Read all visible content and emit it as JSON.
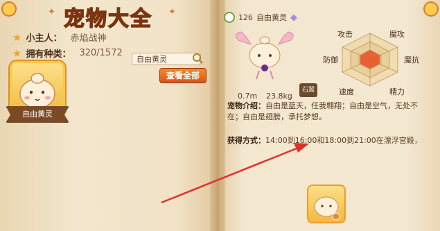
{
  "title": "宠物大全",
  "owner": {
    "label": "小主人：",
    "value": "赤焰战神"
  },
  "species": {
    "label": "拥有种类：",
    "value": "320/1572"
  },
  "selected_pet": {
    "name": "自由黄灵"
  },
  "search": {
    "value": "自由黄灵",
    "icon": "magnifier-icon"
  },
  "view_all_button": {
    "label": "查看全部"
  },
  "pet": {
    "number": "126",
    "name": "自由黄灵",
    "height": "0.7m",
    "weight": "23.8kg",
    "tag": "石翼"
  },
  "stats": {
    "attack": "攻击",
    "magic_attack": "魔攻",
    "magic_resist": "魔抗",
    "defense": "防御",
    "speed": "速度",
    "spirit": "精力"
  },
  "intro": {
    "label": "宠物介绍：",
    "text": "自由是蓝天，任我翱翔；自由是空气，无处不在；自由是翅膀，承托梦想。"
  },
  "obtain": {
    "label": "获得方式：",
    "text": "14:00到16:00和18:00到21:00在漂浮宫殿，"
  },
  "colors": {
    "accent": "#e8762c",
    "button": "#e06a22",
    "page": "#f3e6cc"
  }
}
